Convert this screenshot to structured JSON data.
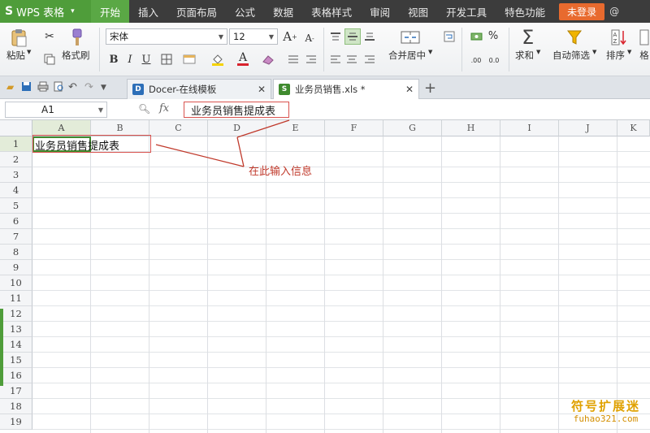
{
  "app": {
    "logo": "S",
    "name": "WPS 表格",
    "caret": "▾"
  },
  "menu": {
    "items": [
      "开始",
      "插入",
      "页面布局",
      "公式",
      "数据",
      "表格样式",
      "审阅",
      "视图",
      "开发工具",
      "特色功能"
    ],
    "active_index": 0,
    "login": "未登录",
    "trailing": "@"
  },
  "ribbon": {
    "paste": "粘贴",
    "format_painter": "格式刷",
    "font_name": "宋体",
    "font_size": "12",
    "bold": "B",
    "italic": "I",
    "underline": "U",
    "grow_font": "A",
    "shrink_font": "A",
    "font_color": "A",
    "merge_center": "合并居中",
    "sum": "求和",
    "auto_filter": "自动筛选",
    "sort": "排序",
    "trailing_label": "格",
    "percent": "%",
    "inc_decimal": ".00",
    "dec_decimal": "0.0"
  },
  "tabs": {
    "items": [
      {
        "label": "Docer-在线模板",
        "icon": "D",
        "icon_color": "#2d6fb8"
      },
      {
        "label": "业务员销售.xls *",
        "icon": "S",
        "icon_color": "#3f8a2e"
      }
    ],
    "active_index": 1,
    "add": "+",
    "close": "✕"
  },
  "formula_bar": {
    "cell_ref": "A1",
    "fx": "fx",
    "content": "业务员销售提成表"
  },
  "sheet": {
    "columns": [
      "A",
      "B",
      "C",
      "D",
      "E",
      "F",
      "G",
      "H",
      "I",
      "J",
      "K"
    ],
    "rows": [
      "1",
      "2",
      "3",
      "4",
      "5",
      "6",
      "7",
      "8",
      "9",
      "10",
      "11",
      "12",
      "13",
      "14",
      "15",
      "16",
      "17",
      "18",
      "19"
    ],
    "cell_a1": "业务员销售提成表",
    "selected_cell": "A1"
  },
  "annotation": "在此输入信息",
  "watermark": {
    "line1": "符号扩展迷",
    "line2": "fuhao321.com"
  },
  "colors": {
    "menubar": "#3c3c3c",
    "accent_green": "#4f9d3a",
    "highlight_red": "#d9534f",
    "login": "#e86a2e"
  }
}
